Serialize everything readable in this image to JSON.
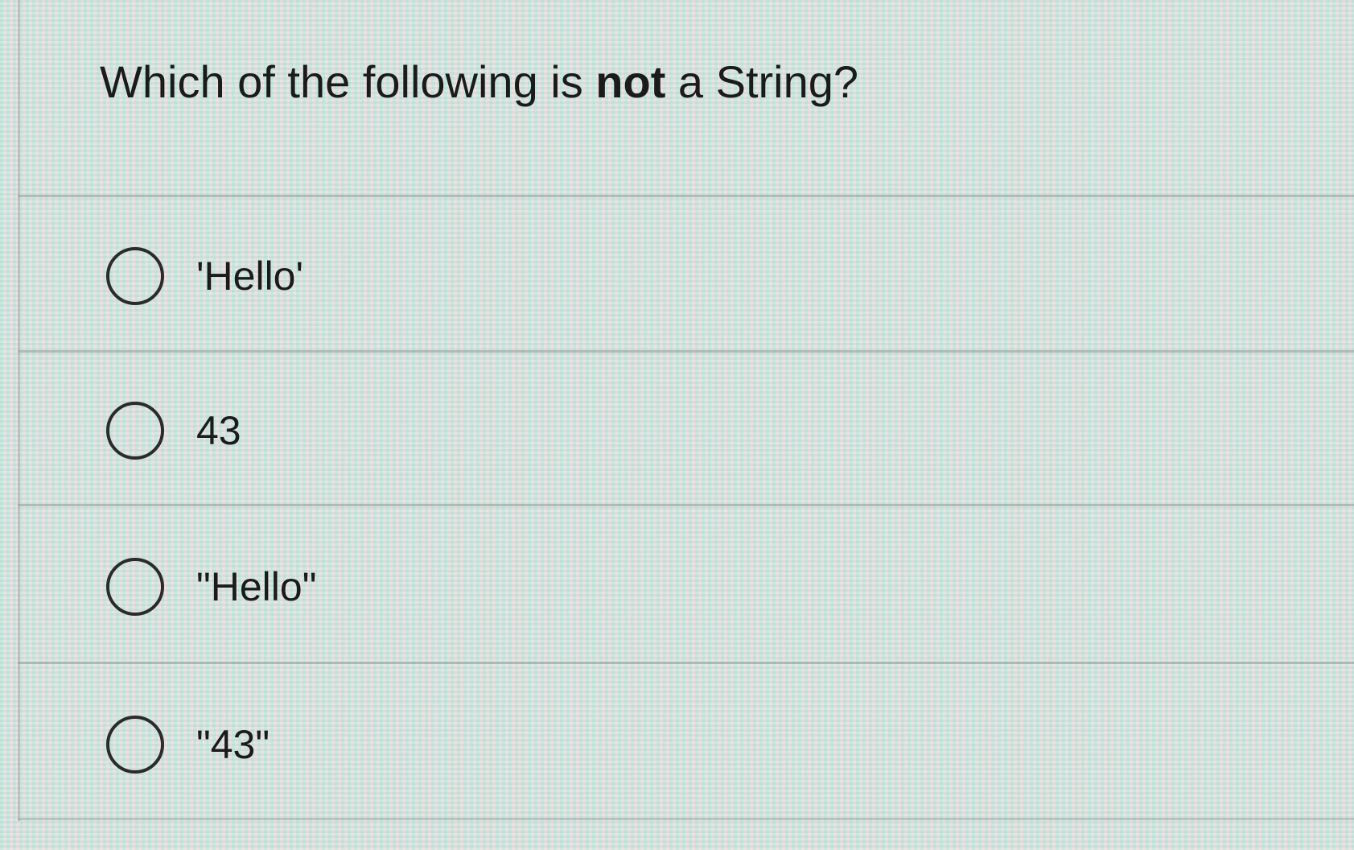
{
  "question": {
    "text_before": "Which of the following is ",
    "text_emphasis": "not",
    "text_after": " a String?"
  },
  "options": [
    {
      "label": "'Hello'",
      "selected": false
    },
    {
      "label": "43",
      "selected": false
    },
    {
      "label": "\"Hello\"",
      "selected": false
    },
    {
      "label": "\"43\"",
      "selected": false
    }
  ]
}
